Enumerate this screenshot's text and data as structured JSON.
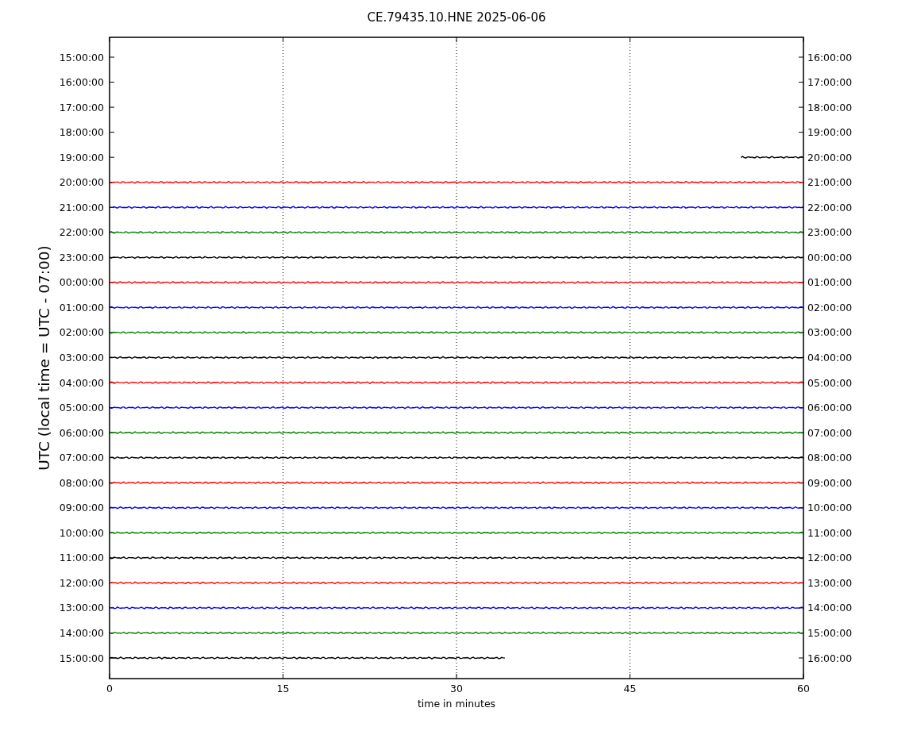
{
  "title": "CE.79435.10.HNE 2025-06-06",
  "chart": {
    "ylabel": "UTC (local time = UTC - 07:00)",
    "xlabel": "time in minutes",
    "xticks": [
      "0",
      "15",
      "30",
      "45",
      "60"
    ],
    "rows": [
      {
        "left": "15:00:00",
        "right": "16:00:00"
      },
      {
        "left": "16:00:00",
        "right": "17:00:00"
      },
      {
        "left": "17:00:00",
        "right": "18:00:00"
      },
      {
        "left": "18:00:00",
        "right": "19:00:00"
      },
      {
        "left": "19:00:00",
        "right": "20:00:00",
        "trace": {
          "color": "#000000",
          "kind": "tail",
          "level": 0.09
        }
      },
      {
        "left": "20:00:00",
        "right": "21:00:00",
        "trace": {
          "color": "#ff0000",
          "kind": "full",
          "level": 1
        }
      },
      {
        "left": "21:00:00",
        "right": "22:00:00",
        "trace": {
          "color": "#0000ff",
          "kind": "full",
          "level": 1
        }
      },
      {
        "left": "22:00:00",
        "right": "23:00:00",
        "trace": {
          "color": "#008000",
          "kind": "full",
          "level": 1
        }
      },
      {
        "left": "23:00:00",
        "right": "00:00:00",
        "trace": {
          "color": "#000000",
          "kind": "full",
          "level": 1
        }
      },
      {
        "left": "00:00:00",
        "right": "01:00:00",
        "trace": {
          "color": "#ff0000",
          "kind": "full",
          "level": 1
        }
      },
      {
        "left": "01:00:00",
        "right": "02:00:00",
        "trace": {
          "color": "#0000ff",
          "kind": "full",
          "level": 1
        }
      },
      {
        "left": "02:00:00",
        "right": "03:00:00",
        "trace": {
          "color": "#008000",
          "kind": "full",
          "level": 1
        }
      },
      {
        "left": "03:00:00",
        "right": "04:00:00",
        "trace": {
          "color": "#000000",
          "kind": "full",
          "level": 1
        }
      },
      {
        "left": "04:00:00",
        "right": "05:00:00",
        "trace": {
          "color": "#ff0000",
          "kind": "full",
          "level": 1
        }
      },
      {
        "left": "05:00:00",
        "right": "06:00:00",
        "trace": {
          "color": "#0000ff",
          "kind": "full",
          "level": 1
        }
      },
      {
        "left": "06:00:00",
        "right": "07:00:00",
        "trace": {
          "color": "#008000",
          "kind": "full",
          "level": 1
        }
      },
      {
        "left": "07:00:00",
        "right": "08:00:00",
        "trace": {
          "color": "#000000",
          "kind": "full",
          "level": 1
        }
      },
      {
        "left": "08:00:00",
        "right": "09:00:00",
        "trace": {
          "color": "#ff0000",
          "kind": "full",
          "level": 1
        }
      },
      {
        "left": "09:00:00",
        "right": "10:00:00",
        "trace": {
          "color": "#0000ff",
          "kind": "full",
          "level": 1
        }
      },
      {
        "left": "10:00:00",
        "right": "11:00:00",
        "trace": {
          "color": "#008000",
          "kind": "full",
          "level": 1
        }
      },
      {
        "left": "11:00:00",
        "right": "12:00:00",
        "trace": {
          "color": "#000000",
          "kind": "full",
          "level": 1
        }
      },
      {
        "left": "12:00:00",
        "right": "13:00:00",
        "trace": {
          "color": "#ff0000",
          "kind": "full",
          "level": 1
        }
      },
      {
        "left": "13:00:00",
        "right": "14:00:00",
        "trace": {
          "color": "#0000ff",
          "kind": "full",
          "level": 1
        }
      },
      {
        "left": "14:00:00",
        "right": "15:00:00",
        "trace": {
          "color": "#008000",
          "kind": "full",
          "level": 1
        }
      },
      {
        "left": "15:00:00",
        "right": "16:00:00",
        "trace": {
          "color": "#000000",
          "kind": "head",
          "level": 0.57
        }
      }
    ]
  }
}
